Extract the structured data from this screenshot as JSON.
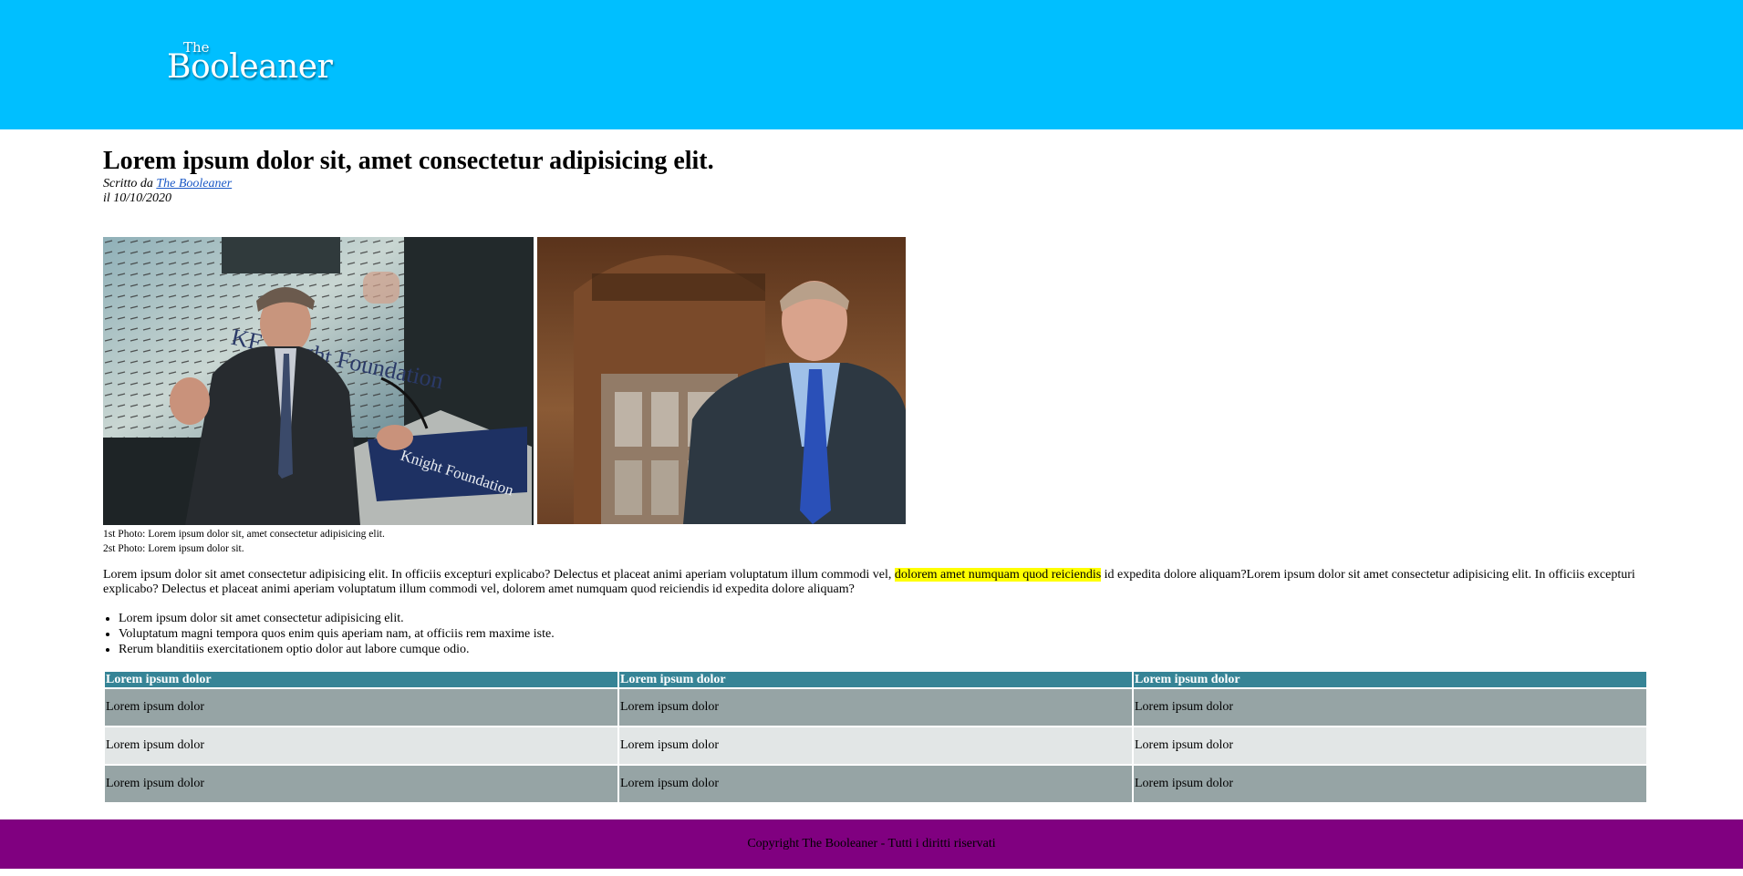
{
  "header": {
    "logo_small": "The",
    "logo_main": "Booleaner",
    "background": "#00bfff"
  },
  "article": {
    "title": "Lorem ipsum dolor sit, amet consectetur adipisicing elit.",
    "byline_prefix": "Scritto da",
    "author": "The Booleaner",
    "date": "il 10/10/2020",
    "photo_1_alt": "Speaker at Knight Foundation podium",
    "photo_2_alt": "Man in suit in front of gothic window",
    "caption_1": "1st Photo: Lorem ipsum dolor sit, amet consectetur adipisicing elit.",
    "caption_2": "2st Photo: Lorem ipsum dolor sit.",
    "paragraph_before": "Lorem ipsum dolor sit amet consectetur adipisicing elit. In officiis excepturi explicabo? Delectus et placeat animi aperiam voluptatum illum commodi vel, ",
    "paragraph_highlight": "dolorem amet numquam quod reiciendis",
    "paragraph_after": " id expedita dolore aliquam?Lorem ipsum dolor sit amet consectetur adipisicing elit. In officiis excepturi explicabo? Delectus et placeat animi aperiam voluptatum illum commodi vel, dolorem amet numquam quod reiciendis id expedita dolore aliquam?",
    "bullets": [
      "Lorem ipsum dolor sit amet consectetur adipisicing elit.",
      "Voluptatum magni tempora quos enim quis aperiam nam, at officiis rem maxime iste.",
      "Rerum blanditiis exercitationem optio dolor aut labore cumque odio."
    ]
  },
  "table": {
    "headers": [
      "Lorem ipsum dolor",
      "Lorem ipsum dolor",
      "Lorem ipsum dolor"
    ],
    "rows": [
      [
        "Lorem ipsum dolor",
        "Lorem ipsum dolor",
        "Lorem ipsum dolor"
      ],
      [
        "Lorem ipsum dolor",
        "Lorem ipsum dolor",
        "Lorem ipsum dolor"
      ],
      [
        "Lorem ipsum dolor",
        "Lorem ipsum dolor",
        "Lorem ipsum dolor"
      ]
    ]
  },
  "footer": {
    "copyright": "Copyright The Booleaner - Tutti i diritti riservati",
    "background": "#800080"
  }
}
